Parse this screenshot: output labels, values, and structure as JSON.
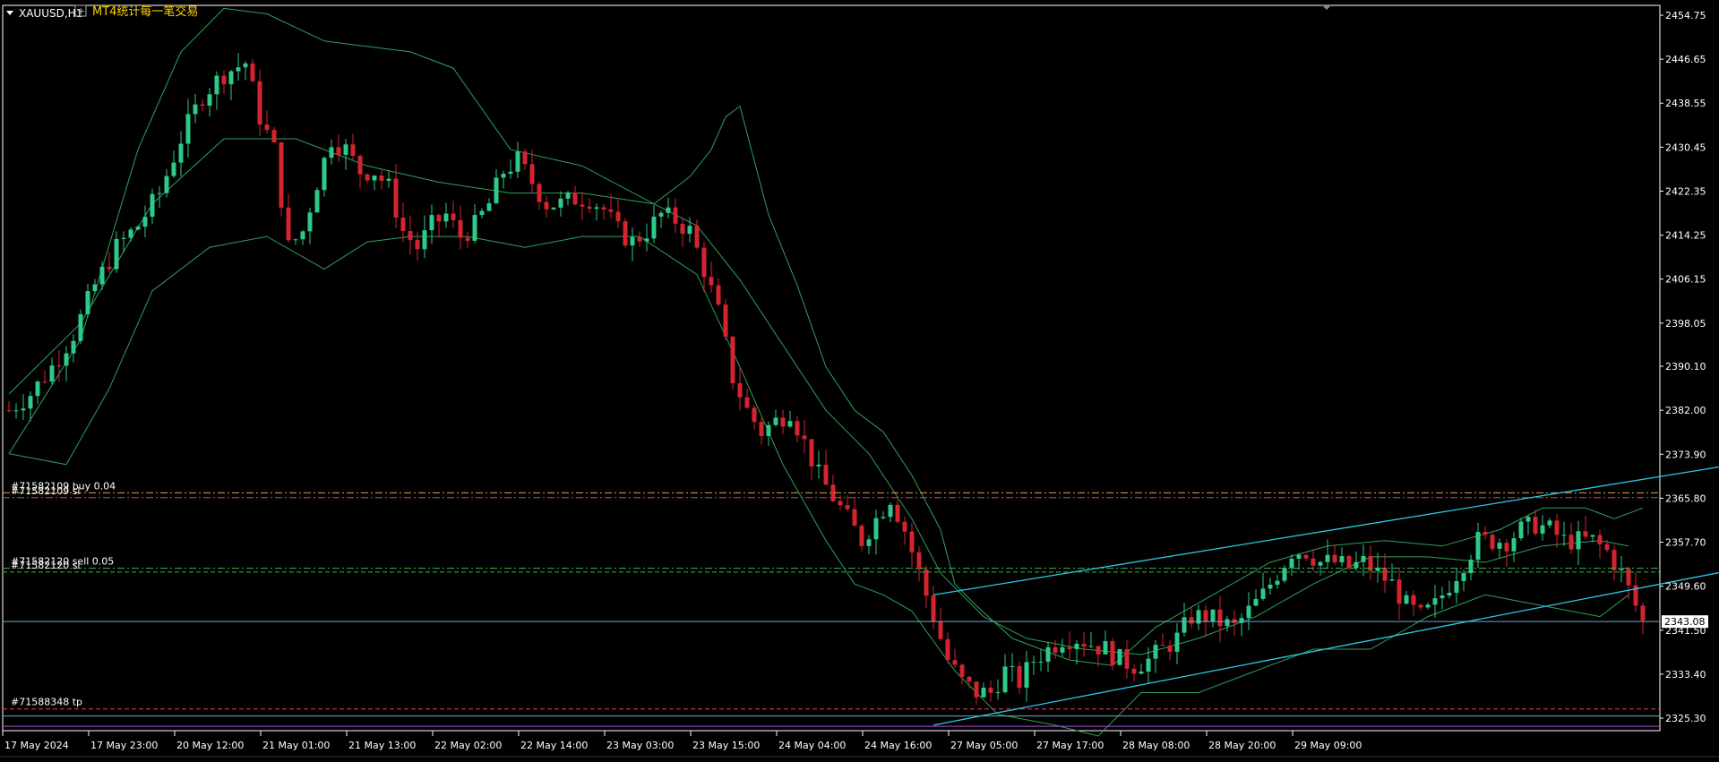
{
  "window": {
    "symbol_label": "XAUUSD,H1",
    "indicator_name": "MT4统计每一笔交易"
  },
  "colors": {
    "background": "#000000",
    "bull_candle": "#2fc98a",
    "bear_candle": "#d4252f",
    "bollinger": "#2fa05a",
    "channel": "#2ec8e6",
    "bid_line": "#6fa8c8",
    "order_buy": "#e8a23a",
    "order_sell": "#37b84a",
    "tp_line": "#e2406b",
    "purple_line": "#b44ae0",
    "axis_text": "#ffffff"
  },
  "chart_data": {
    "type": "candlestick",
    "ylim": [
      2322.0,
      2456.0
    ],
    "y_ticks": [
      "2454.75",
      "2446.65",
      "2438.55",
      "2430.45",
      "2422.35",
      "2414.25",
      "2406.15",
      "2398.05",
      "2390.10",
      "2382.00",
      "2373.90",
      "2365.80",
      "2357.70",
      "2349.60",
      "2341.50",
      "2333.40",
      "2325.30"
    ],
    "x_ticks": [
      "17 May 2024",
      "17 May 23:00",
      "20 May 12:00",
      "21 May 01:00",
      "21 May 13:00",
      "22 May 02:00",
      "22 May 14:00",
      "23 May 03:00",
      "23 May 15:00",
      "24 May 04:00",
      "24 May 16:00",
      "27 May 05:00",
      "27 May 17:00",
      "28 May 08:00",
      "28 May 20:00",
      "29 May 09:00"
    ],
    "current_price": "2343.08",
    "anchors": [
      [
        0,
        2382
      ],
      [
        3,
        2385
      ],
      [
        6,
        2390
      ],
      [
        9,
        2396
      ],
      [
        12,
        2405
      ],
      [
        15,
        2412
      ],
      [
        18,
        2416
      ],
      [
        21,
        2422
      ],
      [
        24,
        2432
      ],
      [
        27,
        2440
      ],
      [
        30,
        2444
      ],
      [
        33,
        2446
      ],
      [
        35,
        2436
      ],
      [
        37,
        2430
      ],
      [
        39,
        2412
      ],
      [
        41,
        2415
      ],
      [
        43,
        2424
      ],
      [
        45,
        2432
      ],
      [
        47,
        2430
      ],
      [
        49,
        2426
      ],
      [
        51,
        2426
      ],
      [
        53,
        2423
      ],
      [
        55,
        2415
      ],
      [
        57,
        2412
      ],
      [
        59,
        2416
      ],
      [
        61,
        2418
      ],
      [
        63,
        2414
      ],
      [
        65,
        2416
      ],
      [
        67,
        2420
      ],
      [
        69,
        2426
      ],
      [
        71,
        2428
      ],
      [
        73,
        2424
      ],
      [
        75,
        2420
      ],
      [
        77,
        2420
      ],
      [
        79,
        2421
      ],
      [
        81,
        2421
      ],
      [
        83,
        2419
      ],
      [
        85,
        2415
      ],
      [
        87,
        2413
      ],
      [
        89,
        2415
      ],
      [
        91,
        2418
      ],
      [
        93,
        2417
      ],
      [
        95,
        2415
      ],
      [
        97,
        2408
      ],
      [
        99,
        2400
      ],
      [
        101,
        2388
      ],
      [
        103,
        2382
      ],
      [
        105,
        2378
      ],
      [
        107,
        2380
      ],
      [
        109,
        2382
      ],
      [
        111,
        2376
      ],
      [
        113,
        2370
      ],
      [
        115,
        2366
      ],
      [
        117,
        2362
      ],
      [
        119,
        2358
      ],
      [
        121,
        2362
      ],
      [
        123,
        2366
      ],
      [
        125,
        2360
      ],
      [
        127,
        2352
      ],
      [
        129,
        2344
      ],
      [
        131,
        2336
      ],
      [
        133,
        2332
      ],
      [
        135,
        2330
      ],
      [
        137,
        2330
      ],
      [
        139,
        2334
      ],
      [
        141,
        2332
      ],
      [
        143,
        2336
      ],
      [
        145,
        2338
      ],
      [
        147,
        2340
      ],
      [
        149,
        2340
      ],
      [
        151,
        2339
      ],
      [
        153,
        2338
      ],
      [
        155,
        2336
      ],
      [
        157,
        2335
      ],
      [
        159,
        2336
      ],
      [
        161,
        2338
      ],
      [
        163,
        2340
      ],
      [
        165,
        2344
      ],
      [
        167,
        2344
      ],
      [
        169,
        2343
      ],
      [
        171,
        2342
      ],
      [
        173,
        2345
      ],
      [
        175,
        2348
      ],
      [
        177,
        2352
      ],
      [
        179,
        2356
      ],
      [
        181,
        2356
      ],
      [
        183,
        2354
      ],
      [
        185,
        2354
      ],
      [
        187,
        2353
      ],
      [
        189,
        2354
      ],
      [
        191,
        2352
      ],
      [
        193,
        2350
      ],
      [
        195,
        2346
      ],
      [
        197,
        2344
      ],
      [
        199,
        2346
      ],
      [
        201,
        2350
      ],
      [
        203,
        2354
      ],
      [
        205,
        2358
      ],
      [
        207,
        2358
      ],
      [
        209,
        2358
      ],
      [
        211,
        2360
      ],
      [
        213,
        2361
      ],
      [
        215,
        2360
      ],
      [
        217,
        2358
      ],
      [
        219,
        2358
      ],
      [
        221,
        2358
      ],
      [
        223,
        2356
      ],
      [
        225,
        2352
      ],
      [
        227,
        2346
      ],
      [
        228,
        2343
      ]
    ],
    "bollinger": {
      "upper": [
        [
          0,
          2374
        ],
        [
          10,
          2395
        ],
        [
          18,
          2430
        ],
        [
          24,
          2448
        ],
        [
          30,
          2456
        ],
        [
          36,
          2455
        ],
        [
          44,
          2450
        ],
        [
          56,
          2448
        ],
        [
          62,
          2445
        ],
        [
          70,
          2430
        ],
        [
          80,
          2427
        ],
        [
          90,
          2420
        ],
        [
          95,
          2425
        ],
        [
          98,
          2430
        ],
        [
          100,
          2436
        ],
        [
          102,
          2438
        ],
        [
          104,
          2428
        ],
        [
          106,
          2418
        ],
        [
          110,
          2405
        ],
        [
          114,
          2390
        ],
        [
          118,
          2382
        ],
        [
          122,
          2378
        ],
        [
          126,
          2370
        ],
        [
          130,
          2360
        ],
        [
          132,
          2350
        ],
        [
          135,
          2346
        ],
        [
          140,
          2340
        ],
        [
          148,
          2336
        ],
        [
          154,
          2335
        ],
        [
          160,
          2342
        ],
        [
          168,
          2348
        ],
        [
          176,
          2354
        ],
        [
          184,
          2357
        ],
        [
          192,
          2358
        ],
        [
          200,
          2357
        ],
        [
          208,
          2360
        ],
        [
          214,
          2364
        ],
        [
          220,
          2364
        ],
        [
          224,
          2362
        ],
        [
          228,
          2364
        ]
      ],
      "middle": [
        [
          0,
          2385
        ],
        [
          10,
          2398
        ],
        [
          20,
          2420
        ],
        [
          30,
          2432
        ],
        [
          40,
          2432
        ],
        [
          50,
          2427
        ],
        [
          60,
          2424
        ],
        [
          70,
          2422
        ],
        [
          80,
          2422
        ],
        [
          90,
          2420
        ],
        [
          96,
          2416
        ],
        [
          102,
          2406
        ],
        [
          108,
          2394
        ],
        [
          114,
          2382
        ],
        [
          120,
          2374
        ],
        [
          126,
          2362
        ],
        [
          130,
          2352
        ],
        [
          136,
          2344
        ],
        [
          142,
          2340
        ],
        [
          150,
          2338
        ],
        [
          158,
          2337
        ],
        [
          166,
          2340
        ],
        [
          174,
          2344
        ],
        [
          182,
          2350
        ],
        [
          190,
          2355
        ],
        [
          198,
          2355
        ],
        [
          206,
          2354
        ],
        [
          214,
          2357
        ],
        [
          222,
          2358
        ],
        [
          226,
          2357
        ]
      ],
      "lower": [
        [
          0,
          2374
        ],
        [
          8,
          2372
        ],
        [
          14,
          2386
        ],
        [
          20,
          2404
        ],
        [
          28,
          2412
        ],
        [
          36,
          2414
        ],
        [
          44,
          2408
        ],
        [
          50,
          2413
        ],
        [
          56,
          2414
        ],
        [
          64,
          2414
        ],
        [
          72,
          2412
        ],
        [
          80,
          2414
        ],
        [
          88,
          2414
        ],
        [
          96,
          2407
        ],
        [
          102,
          2390
        ],
        [
          108,
          2372
        ],
        [
          114,
          2358
        ],
        [
          118,
          2350
        ],
        [
          122,
          2348
        ],
        [
          126,
          2345
        ],
        [
          132,
          2334
        ],
        [
          138,
          2326
        ],
        [
          146,
          2324
        ],
        [
          152,
          2322
        ],
        [
          158,
          2330
        ],
        [
          166,
          2330
        ],
        [
          174,
          2334
        ],
        [
          182,
          2338
        ],
        [
          190,
          2338
        ],
        [
          198,
          2344
        ],
        [
          206,
          2348
        ],
        [
          214,
          2346
        ],
        [
          222,
          2344
        ],
        [
          226,
          2348
        ]
      ]
    },
    "channel_lines": [
      {
        "from": [
          129,
          2348
        ],
        "to": [
          250,
          2374
        ]
      },
      {
        "from": [
          129,
          2324
        ],
        "to": [
          250,
          2355
        ]
      }
    ],
    "order_lines": [
      {
        "price": 2366.8,
        "style": "dashdot",
        "color": "order_buy",
        "label": "#71582109 buy 0.04"
      },
      {
        "price": 2365.9,
        "style": "dashdot",
        "color": "tp_line",
        "label": "#71582109 sl"
      },
      {
        "price": 2352.9,
        "style": "dashdot",
        "color": "order_sell",
        "label": "#71582120 sell 0.05"
      },
      {
        "price": 2352.2,
        "style": "dash",
        "color": "order_sell",
        "label": "#71582120 sl"
      },
      {
        "price": 2327.0,
        "style": "dash",
        "color": "tp_line",
        "label": "#71588348 tp"
      },
      {
        "price": 2325.7,
        "style": "solid",
        "color": "bid_line",
        "label": ""
      },
      {
        "price": 2323.8,
        "style": "solid",
        "color": "purple_line",
        "label": ""
      }
    ]
  }
}
